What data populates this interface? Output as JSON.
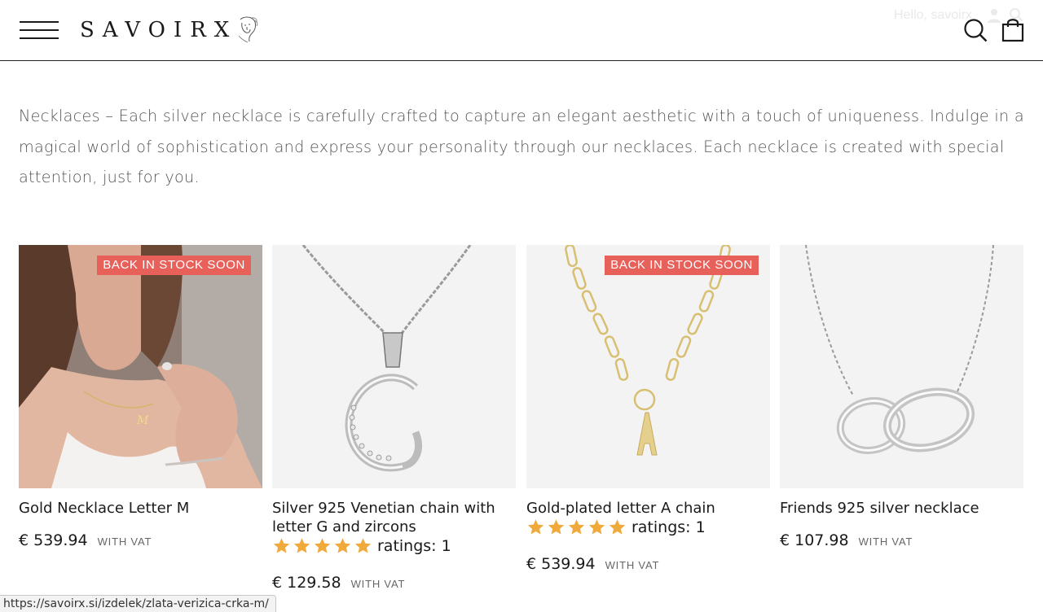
{
  "header": {
    "logo_text": "SAVOIRX",
    "greeting": "Hello, savoirx"
  },
  "description": "Necklaces – Each silver necklace is carefully crafted to capture an elegant aesthetic with a touch of uniqueness. Indulge in a magical world of sophistication and express your personality through our necklaces. Each necklace is created with special attention, just for you.",
  "products": [
    {
      "title": "Gold Necklace Letter M",
      "badge": "BACK IN STOCK SOON",
      "rating_text": "",
      "price": "€ 539.94",
      "vat": "WITH VAT"
    },
    {
      "title": "Silver 925 Venetian chain with letter G and zircons",
      "badge": "",
      "rating_text": "ratings: 1",
      "price": "€ 129.58",
      "vat": "WITH VAT"
    },
    {
      "title": "Gold-plated letter A chain",
      "badge": "BACK IN STOCK SOON",
      "rating_text": "ratings: 1",
      "price": "€ 539.94",
      "vat": "WITH VAT"
    },
    {
      "title": "Friends 925 silver necklace",
      "badge": "",
      "rating_text": "",
      "price": "€ 107.98",
      "vat": "WITH VAT"
    }
  ],
  "status_bar": {
    "url": "https://savoirx.si/izdelek/zlata-verizica-crka-m/"
  },
  "colors": {
    "badge": "#e8605a",
    "star": "#f0a93b",
    "text": "#1a1a1a"
  }
}
